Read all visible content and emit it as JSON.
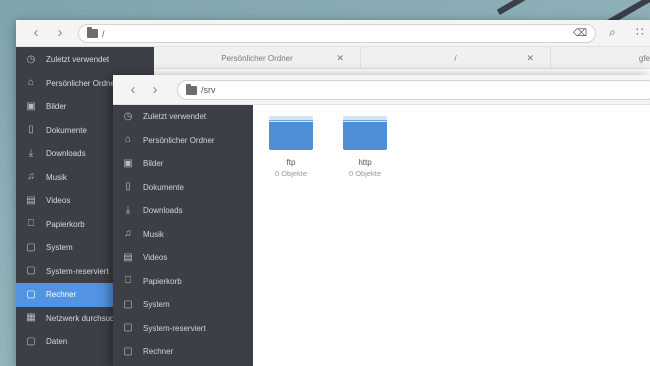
{
  "colors": {
    "sidebar_bg": "#3c4046",
    "accent": "#5294e2",
    "folder_blue": "#4f8fd8"
  },
  "back_window": {
    "location": "/",
    "tabs": [
      {
        "label": "Persönlicher Ordner"
      },
      {
        "label": "/"
      },
      {
        "label": "gfe"
      }
    ],
    "sidebar": [
      {
        "label": "Zuletzt verwendet",
        "icon": "clock-icon"
      },
      {
        "label": "Persönlicher Ordner",
        "icon": "home-icon"
      },
      {
        "label": "Bilder",
        "icon": "image-icon"
      },
      {
        "label": "Dokumente",
        "icon": "document-icon"
      },
      {
        "label": "Downloads",
        "icon": "download-icon"
      },
      {
        "label": "Musik",
        "icon": "music-icon"
      },
      {
        "label": "Videos",
        "icon": "video-icon"
      },
      {
        "label": "Papierkorb",
        "icon": "trash-icon"
      },
      {
        "label": "System",
        "icon": "drive-icon"
      },
      {
        "label": "System-reserviert",
        "icon": "drive-icon"
      },
      {
        "label": "Rechner",
        "icon": "drive-icon",
        "active": true
      },
      {
        "label": "Netzwerk durchsuchen",
        "icon": "network-icon"
      },
      {
        "label": "Daten",
        "icon": "drive-icon"
      }
    ]
  },
  "front_window": {
    "location": "/srv",
    "sidebar": [
      {
        "label": "Zuletzt verwendet",
        "icon": "clock-icon"
      },
      {
        "label": "Persönlicher Ordner",
        "icon": "home-icon"
      },
      {
        "label": "Bilder",
        "icon": "image-icon"
      },
      {
        "label": "Dokumente",
        "icon": "document-icon"
      },
      {
        "label": "Downloads",
        "icon": "download-icon"
      },
      {
        "label": "Musik",
        "icon": "music-icon"
      },
      {
        "label": "Videos",
        "icon": "video-icon"
      },
      {
        "label": "Papierkorb",
        "icon": "trash-icon"
      },
      {
        "label": "System",
        "icon": "drive-icon"
      },
      {
        "label": "System-reserviert",
        "icon": "drive-icon"
      },
      {
        "label": "Rechner",
        "icon": "drive-icon"
      }
    ],
    "files": [
      {
        "name": "ftp",
        "count": "0 Objekte"
      },
      {
        "name": "http",
        "count": "0 Objekte"
      }
    ]
  }
}
